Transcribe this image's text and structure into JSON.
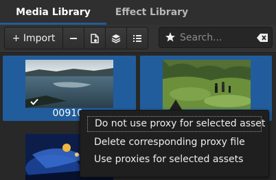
{
  "tabs": [
    {
      "label": "Media Library"
    },
    {
      "label": "Effect Library"
    }
  ],
  "toolbar": {
    "import_label": "+ Import",
    "remove_icon": "minus-icon",
    "clip_properties_icon": "document-icon",
    "proxy_icon": "layers-icon",
    "view_mode_icon": "list-icon"
  },
  "search": {
    "placeholder": "Search...",
    "value": "",
    "star_icon": "star-icon",
    "clear_icon": "clear-icon"
  },
  "assets": [
    {
      "caption": "00910.",
      "selected": true
    },
    {
      "caption": "",
      "selected": true
    },
    {
      "caption": "",
      "selected": false
    }
  ],
  "context_menu": {
    "items": [
      {
        "label": "Do not use proxy for selected asset"
      },
      {
        "label": "Delete corresponding proxy file"
      },
      {
        "label": "Use proxies for selected assets"
      }
    ]
  },
  "colors": {
    "accent": "#215d9c",
    "background": "#2d2d2d"
  }
}
